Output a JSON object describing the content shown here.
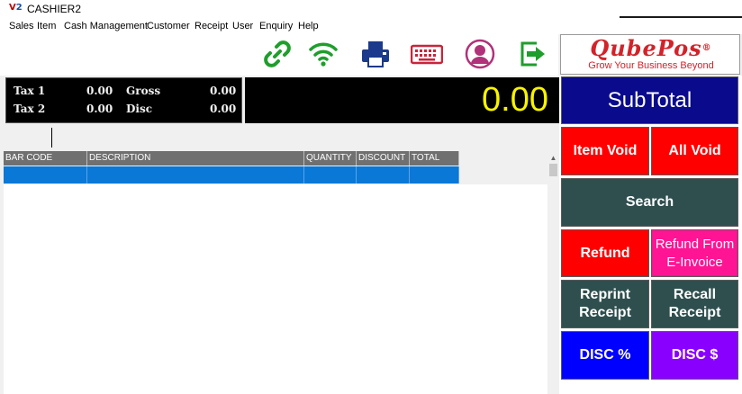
{
  "window": {
    "title": "CASHIER2"
  },
  "menu": [
    "Sales",
    "Item",
    "Cash Management",
    "Customer",
    "Receipt",
    "User",
    "Enquiry",
    "Help"
  ],
  "toolbar": {
    "icons": [
      "link-icon",
      "wifi-icon",
      "printer-icon",
      "keyboard-icon",
      "user-profile-icon",
      "exit-icon"
    ],
    "colors": {
      "green": "#1f9e2c",
      "navy": "#1b3a8c",
      "red": "#c8253a",
      "magenta": "#b0327a"
    }
  },
  "brand": {
    "name": "QubePos",
    "mark": "®",
    "tagline": "Grow Your Business Beyond",
    "color": "#d2232a"
  },
  "totals": {
    "tax1_label": "Tax 1",
    "tax1_value": "0.00",
    "tax2_label": "Tax 2",
    "tax2_value": "0.00",
    "gross_label": "Gross",
    "gross_value": "0.00",
    "disc_label": "Disc",
    "disc_value": "0.00",
    "display_total": "0.00",
    "display_color": "#f8f400"
  },
  "grid": {
    "columns": [
      "BAR CODE",
      "DESCRIPTION",
      "QUANTITY",
      "DISCOUNT",
      "TOTAL"
    ],
    "selected_row": [
      "",
      "",
      "",
      "",
      ""
    ],
    "header_color": "#707070",
    "selection_color": "#0a78d7"
  },
  "buttons": {
    "subtotal": "SubTotal",
    "item_void": "Item Void",
    "all_void": "All Void",
    "search": "Search",
    "refund": "Refund",
    "refund_einvoice_line1": "Refund From",
    "refund_einvoice_line2": "E-Invoice",
    "reprint_line1": "Reprint",
    "reprint_line2": "Receipt",
    "recall_line1": "Recall",
    "recall_line2": "Receipt",
    "disc_percent": "DISC %",
    "disc_amount": "DISC $",
    "colors": {
      "subtotal": "#0a0a8c",
      "void": "#ff0000",
      "search": "#2f4f4f",
      "refund": "#ff0000",
      "refund_einvoice": "#ff1493",
      "reprint": "#2f4f4f",
      "recall": "#2f4f4f",
      "disc_percent": "#0000ff",
      "disc_amount": "#8a00ff"
    }
  }
}
